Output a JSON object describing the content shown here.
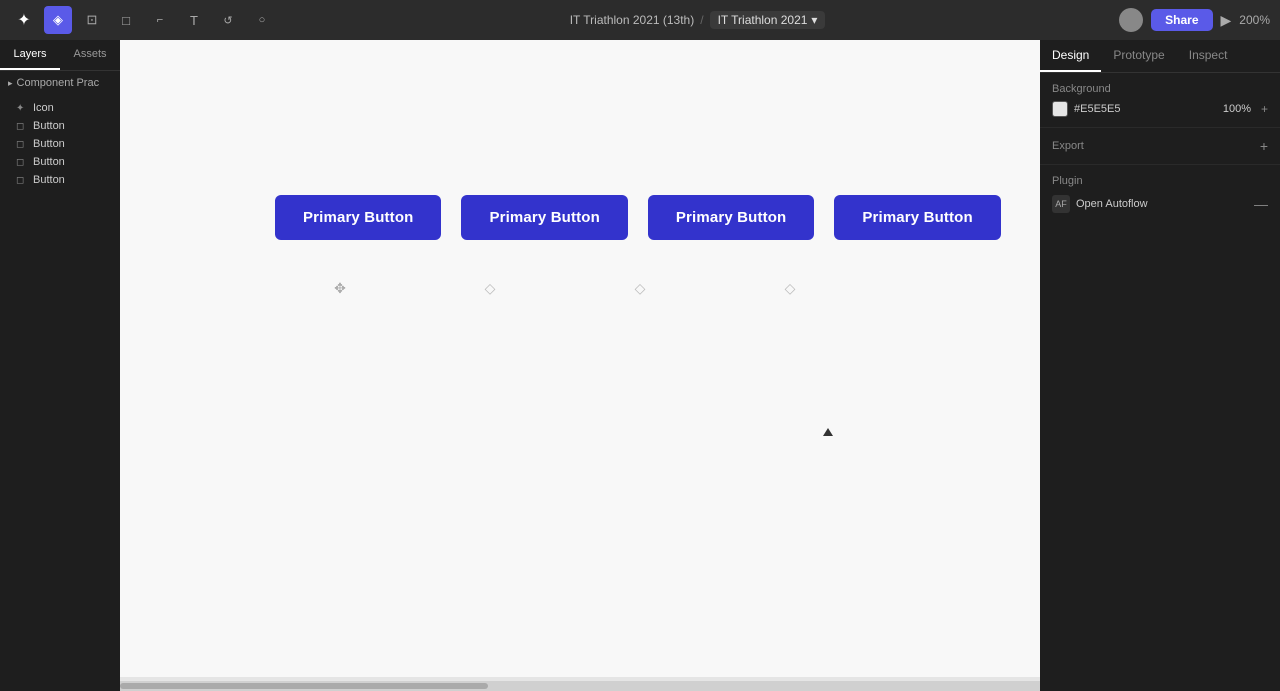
{
  "topbar": {
    "title": "IT Triathlon 2021 (13th)",
    "breadcrumb_sep": "/",
    "current_page": "IT Triathlon 2021",
    "chevron": "▾",
    "share_label": "Share",
    "zoom_label": "200%",
    "tools": [
      {
        "name": "select-tool",
        "icon": "◈",
        "active": true
      },
      {
        "name": "frame-tool",
        "icon": "⊡",
        "active": false
      },
      {
        "name": "shape-tool",
        "icon": "□",
        "active": false
      },
      {
        "name": "pen-tool",
        "icon": "⌐",
        "active": false
      },
      {
        "name": "text-tool",
        "icon": "T",
        "active": false
      },
      {
        "name": "component-tool",
        "icon": "↺",
        "active": false
      },
      {
        "name": "comment-tool",
        "icon": "○",
        "active": false
      }
    ]
  },
  "sidebar": {
    "tabs": [
      {
        "label": "Layers",
        "active": true
      },
      {
        "label": "Assets",
        "active": false
      }
    ],
    "page_header": {
      "expand_icon": "▸",
      "label": "Component Prac"
    },
    "layers": [
      {
        "icon": "✦",
        "label": "Icon"
      },
      {
        "icon": "◻",
        "label": "Button"
      },
      {
        "icon": "◻",
        "label": "Button"
      },
      {
        "icon": "◻",
        "label": "Button"
      },
      {
        "icon": "◻",
        "label": "Button"
      }
    ]
  },
  "canvas": {
    "bg_color": "#e5e5e5",
    "buttons": [
      {
        "label": "Primary Button"
      },
      {
        "label": "Primary Button"
      },
      {
        "label": "Primary Button"
      },
      {
        "label": "Primary Button"
      }
    ]
  },
  "right_panel": {
    "tabs": [
      {
        "label": "Design",
        "active": true
      },
      {
        "label": "Prototype",
        "active": false
      },
      {
        "label": "Inspect",
        "active": false
      }
    ],
    "background": {
      "section_label": "Background",
      "color": "#E5E5E5",
      "opacity": "100%"
    },
    "export": {
      "section_label": "Export",
      "add_icon": "+"
    },
    "plugin": {
      "section_label": "Plugin",
      "name": "Open Autoflow",
      "icon": "AF",
      "minus_icon": "—"
    }
  }
}
